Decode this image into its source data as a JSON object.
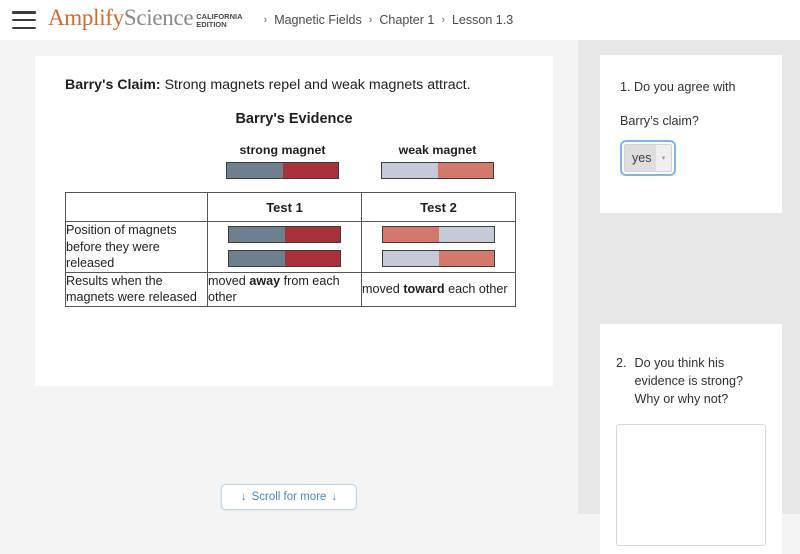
{
  "header": {
    "menu_icon": "hamburger-menu-icon",
    "logo": {
      "amplify": "Amplify",
      "science": "Science",
      "edition_line1": "CALIFORNIA",
      "edition_line2": "EDITION"
    },
    "breadcrumb": {
      "separator": "›",
      "items": [
        "Magnetic Fields",
        "Chapter 1",
        "Lesson 1.3"
      ]
    }
  },
  "main": {
    "claim_label": "Barry's Claim:",
    "claim_text": " Strong magnets repel and weak magnets attract.",
    "evidence_title": "Barry's Evidence",
    "key": [
      {
        "label": "strong magnet",
        "left_color": "#6e8090",
        "right_color": "#a8313a"
      },
      {
        "label": "weak magnet",
        "left_color": "#c6cad8",
        "right_color": "#d4786c"
      }
    ],
    "table": {
      "corner_header": "",
      "column_headers": [
        "Test 1",
        "Test 2"
      ],
      "rows": [
        {
          "label": "Position of magnets before they were released",
          "type": "magnets",
          "test1": [
            {
              "left_color": "#6e8090",
              "right_color": "#a8313a"
            },
            {
              "left_color": "#6e8090",
              "right_color": "#a8313a"
            }
          ],
          "test2": [
            {
              "left_color": "#d4786c",
              "right_color": "#c6cad8"
            },
            {
              "left_color": "#c6cad8",
              "right_color": "#d4786c"
            }
          ]
        },
        {
          "label": "Results when the magnets were released",
          "type": "text",
          "test1_pre": "moved ",
          "test1_bold": "away",
          "test1_post": " from each other",
          "test2_pre": "moved ",
          "test2_bold": "toward",
          "test2_post": " each other"
        }
      ]
    },
    "scroll_button": {
      "arrow_left": "↓",
      "label": "Scroll for more",
      "arrow_right": "↓"
    }
  },
  "sidebar": {
    "question1": {
      "line1": "1. Do you agree with",
      "line2": "Barry’s claim?",
      "select_value": "yes",
      "select_caret": "▾",
      "focus_color": "#7fb6e8"
    },
    "question2": {
      "number": "2.",
      "text": "Do you think his evidence is strong? Why or why not?",
      "answer_value": "",
      "answer_placeholder": ""
    }
  },
  "colors": {
    "brand_orange": "#d4672a",
    "page_bg": "#f4f4f4",
    "sidebar_bg": "#e7e7e7",
    "link_blue": "#4a84b8"
  }
}
